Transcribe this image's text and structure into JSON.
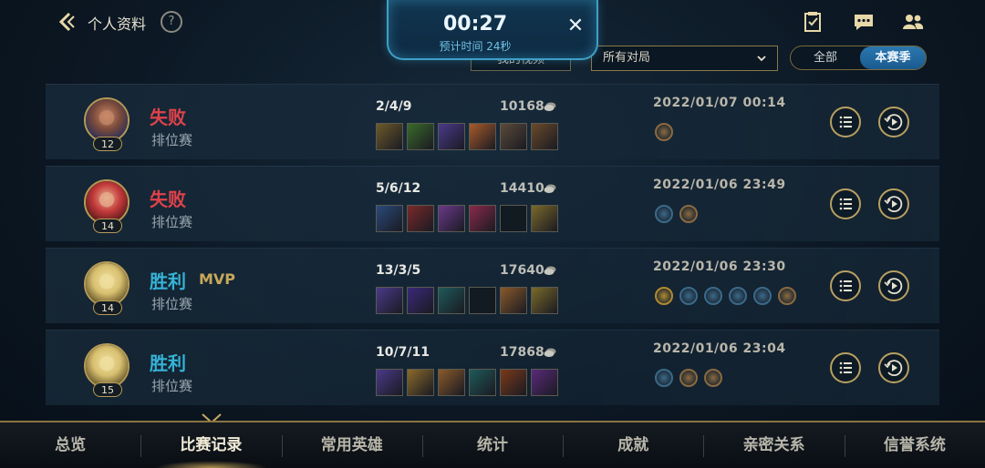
{
  "header": {
    "title": "个人资料",
    "help": "?",
    "icons": [
      "task-icon",
      "chat-icon",
      "friends-icon"
    ]
  },
  "timer": {
    "time": "00:27",
    "estimate": "预计时间 24秒",
    "close": "✕"
  },
  "filters": {
    "video_button": "我的视频",
    "match_filter": "所有对局",
    "toggle": {
      "all": "全部",
      "season": "本赛季",
      "selected": "season"
    }
  },
  "matches": [
    {
      "result": "失败",
      "outcome": "lose",
      "mvp": "",
      "mode": "排位赛",
      "level": "12",
      "kda": "2/4/9",
      "gold": "10168",
      "datetime": "2022/01/07 00:14",
      "items": [
        "#6d5a2a",
        "#3a6a2a",
        "#4a3a8a",
        "#a85a2a",
        "#5a4a3a",
        "#6a4a2a"
      ],
      "badges": [
        "skull-badge"
      ]
    },
    {
      "result": "失败",
      "outcome": "lose",
      "mvp": "",
      "mode": "排位赛",
      "level": "14",
      "kda": "5/6/12",
      "gold": "14410",
      "datetime": "2022/01/06 23:49",
      "items": [
        "#2a4a7a",
        "#7a2a2a",
        "#6a3a8a",
        "#8a2a4a",
        "#121a22",
        "#7a6a2a"
      ],
      "badges": [
        "assist-badge",
        "skull-badge"
      ]
    },
    {
      "result": "胜利",
      "outcome": "win",
      "mvp": "MVP",
      "mode": "排位赛",
      "level": "14",
      "kda": "13/3/5",
      "gold": "17640",
      "datetime": "2022/01/06 23:30",
      "items": [
        "#4a3a8a",
        "#3a2a7a",
        "#1e5a5a",
        "#121a22",
        "#8a5a2a",
        "#7a6a2a"
      ],
      "badges": [
        "s-badge",
        "triple-badge",
        "tower-badge",
        "shield-badge",
        "sword-badge",
        "fist-badge"
      ]
    },
    {
      "result": "胜利",
      "outcome": "win",
      "mvp": "",
      "mode": "排位赛",
      "level": "15",
      "kda": "10/7/11",
      "gold": "17868",
      "datetime": "2022/01/06 23:04",
      "items": [
        "#4a3a8a",
        "#8a6a2a",
        "#8a5a2a",
        "#1e5a5a",
        "#7a3a1a",
        "#5a2a7a"
      ],
      "badges": [
        "triple-badge",
        "skull-badge",
        "fist-badge"
      ]
    }
  ],
  "nav": {
    "tabs": [
      "总览",
      "比赛记录",
      "常用英雄",
      "统计",
      "成就",
      "亲密关系",
      "信誉系统"
    ],
    "active": 1
  },
  "colors": {
    "lose": "#e0424a",
    "win": "#35b3d6",
    "gold_accent": "#b59a55",
    "toggle_active": "#2a78b0"
  }
}
